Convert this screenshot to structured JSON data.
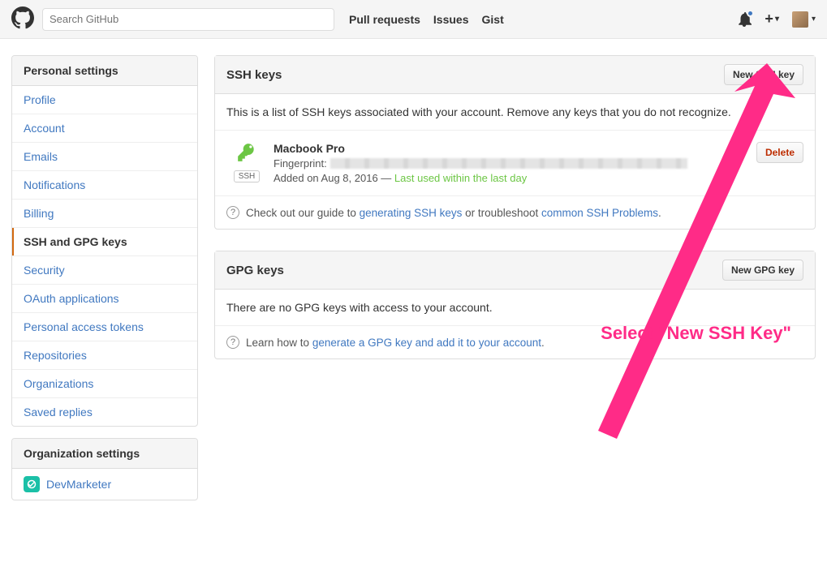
{
  "top": {
    "search_placeholder": "Search GitHub",
    "nav": {
      "pulls": "Pull requests",
      "issues": "Issues",
      "gist": "Gist"
    }
  },
  "sidebar": {
    "personal_header": "Personal settings",
    "items": [
      "Profile",
      "Account",
      "Emails",
      "Notifications",
      "Billing",
      "SSH and GPG keys",
      "Security",
      "OAuth applications",
      "Personal access tokens",
      "Repositories",
      "Organizations",
      "Saved replies"
    ],
    "active_index": 5,
    "org_header": "Organization settings",
    "org_name": "DevMarketer"
  },
  "ssh": {
    "title": "SSH keys",
    "new_btn": "New SSH key",
    "intro": "This is a list of SSH keys associated with your account. Remove any keys that you do not recognize.",
    "key_badge": "SSH",
    "key_title": "Macbook Pro",
    "fingerprint_label": "Fingerprint:",
    "added_prefix": "Added on Aug 8, 2016 — ",
    "last_used": "Last used within the last day",
    "delete_btn": "Delete",
    "guide": {
      "pre": "Check out our guide to ",
      "link1": "generating SSH keys",
      "mid": " or troubleshoot ",
      "link2": "common SSH Problems",
      "post": "."
    }
  },
  "gpg": {
    "title": "GPG keys",
    "new_btn": "New GPG key",
    "empty": "There are no GPG keys with access to your account.",
    "guide": {
      "pre": "Learn how to ",
      "link": "generate a GPG key and add it to your account",
      "post": "."
    }
  },
  "annotation": {
    "text": "Select \"New SSH Key\""
  }
}
